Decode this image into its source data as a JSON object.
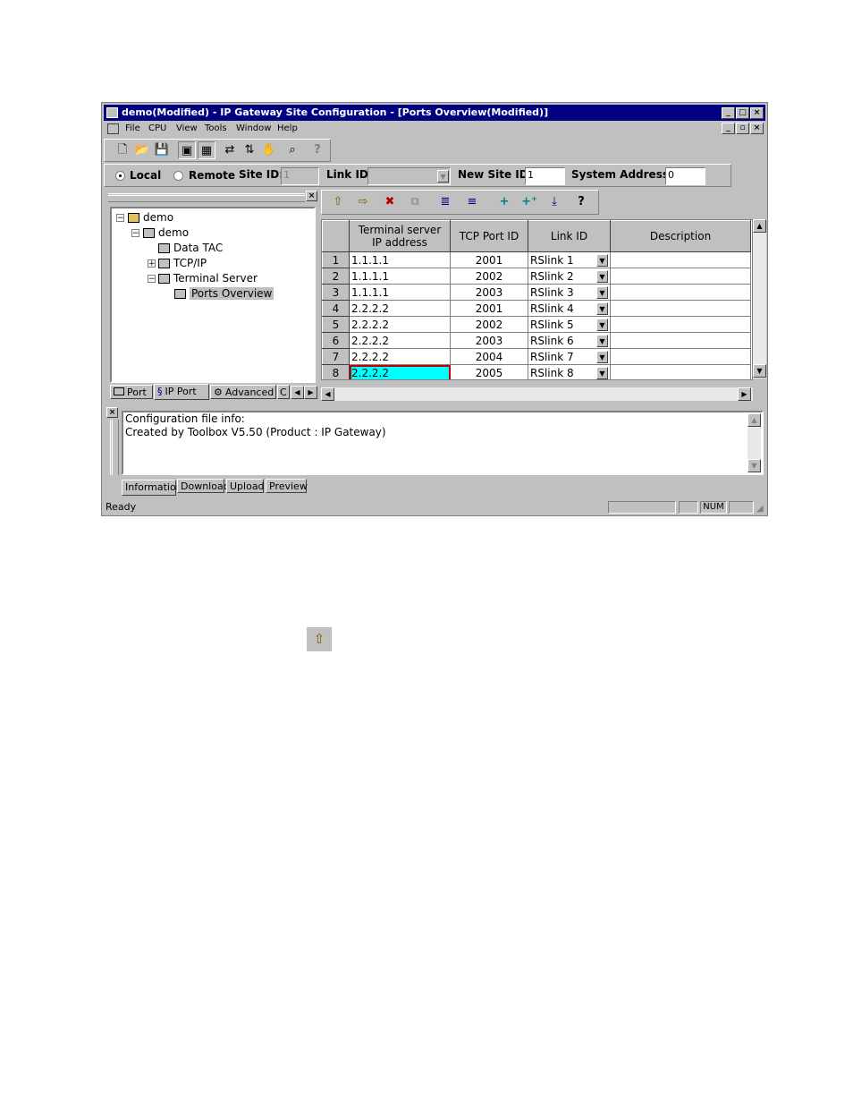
{
  "window": {
    "title": "demo(Modified) - IP Gateway Site Configuration - [Ports Overview(Modified)]"
  },
  "menu": [
    "File",
    "CPU",
    "View",
    "Tools",
    "Window",
    "Help"
  ],
  "site_bar": {
    "local_label": "Local",
    "remote_label": "Remote",
    "selected": "Local",
    "site_id_label": "Site ID:",
    "site_id_value": "1",
    "link_id_label": "Link ID:",
    "link_id_value": "",
    "new_site_id_label": "New Site ID:",
    "new_site_id_value": "1",
    "system_address_label": "System Address:",
    "system_address_value": "0"
  },
  "tree": {
    "root": "demo",
    "child": "demo",
    "items": [
      "Data TAC",
      "TCP/IP",
      "Terminal Server",
      "Ports Overview"
    ],
    "selected": "Ports Overview"
  },
  "left_tabs": [
    "Port",
    "IP Port",
    "Advanced",
    "C"
  ],
  "grid": {
    "headers": {
      "ip_line1": "Terminal server",
      "ip_line2": "IP address",
      "port": "TCP Port ID",
      "link": "Link ID",
      "desc": "Description"
    },
    "rows": [
      {
        "n": "1",
        "ip": "1.1.1.1",
        "port": "2001",
        "link": "RSlink 1",
        "desc": ""
      },
      {
        "n": "2",
        "ip": "1.1.1.1",
        "port": "2002",
        "link": "RSlink 2",
        "desc": ""
      },
      {
        "n": "3",
        "ip": "1.1.1.1",
        "port": "2003",
        "link": "RSlink 3",
        "desc": ""
      },
      {
        "n": "4",
        "ip": "2.2.2.2",
        "port": "2001",
        "link": "RSlink 4",
        "desc": ""
      },
      {
        "n": "5",
        "ip": "2.2.2.2",
        "port": "2002",
        "link": "RSlink 5",
        "desc": ""
      },
      {
        "n": "6",
        "ip": "2.2.2.2",
        "port": "2003",
        "link": "RSlink 6",
        "desc": ""
      },
      {
        "n": "7",
        "ip": "2.2.2.2",
        "port": "2004",
        "link": "RSlink 7",
        "desc": ""
      },
      {
        "n": "8",
        "ip": "2.2.2.2",
        "port": "2005",
        "link": "RSlink 8",
        "desc": ""
      }
    ],
    "selected_cell_color": "#00ffff",
    "selected_border_color": "#c00000"
  },
  "info": {
    "line1": "Configuration file info:",
    "line2": "Created by Toolbox V5.50 (Product : IP Gateway)"
  },
  "bottom_tabs": [
    "Information",
    "Download",
    "Upload",
    "Preview"
  ],
  "status": {
    "text": "Ready",
    "num": "NUM"
  },
  "colors": {
    "titlebar": "#000080",
    "chrome": "#c0c0c0"
  }
}
